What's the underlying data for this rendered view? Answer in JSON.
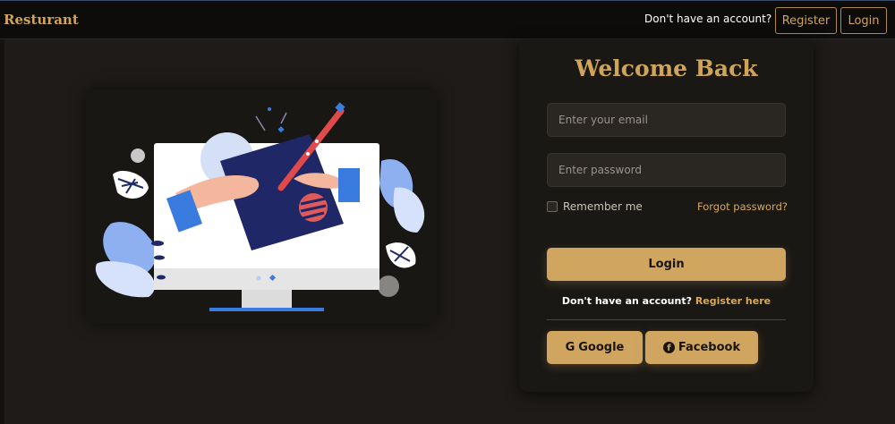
{
  "header": {
    "brand": "Resturant",
    "prompt": "Don't have an account?",
    "register_label": "Register",
    "login_label": "Login"
  },
  "form": {
    "title": "Welcome Back",
    "email_placeholder": "Enter your email",
    "password_placeholder": "Enter password",
    "remember_label": "Remember me",
    "forgot_label": "Forgot password?",
    "login_label": "Login",
    "register_prompt": "Don't have an account?",
    "register_link": "Register here",
    "google_label": "Google",
    "facebook_label": "Facebook",
    "google_icon": "G",
    "facebook_icon": "f"
  },
  "colors": {
    "accent": "#cfa55f",
    "background": "#1e1b18",
    "topbar": "#0d0c0b"
  }
}
